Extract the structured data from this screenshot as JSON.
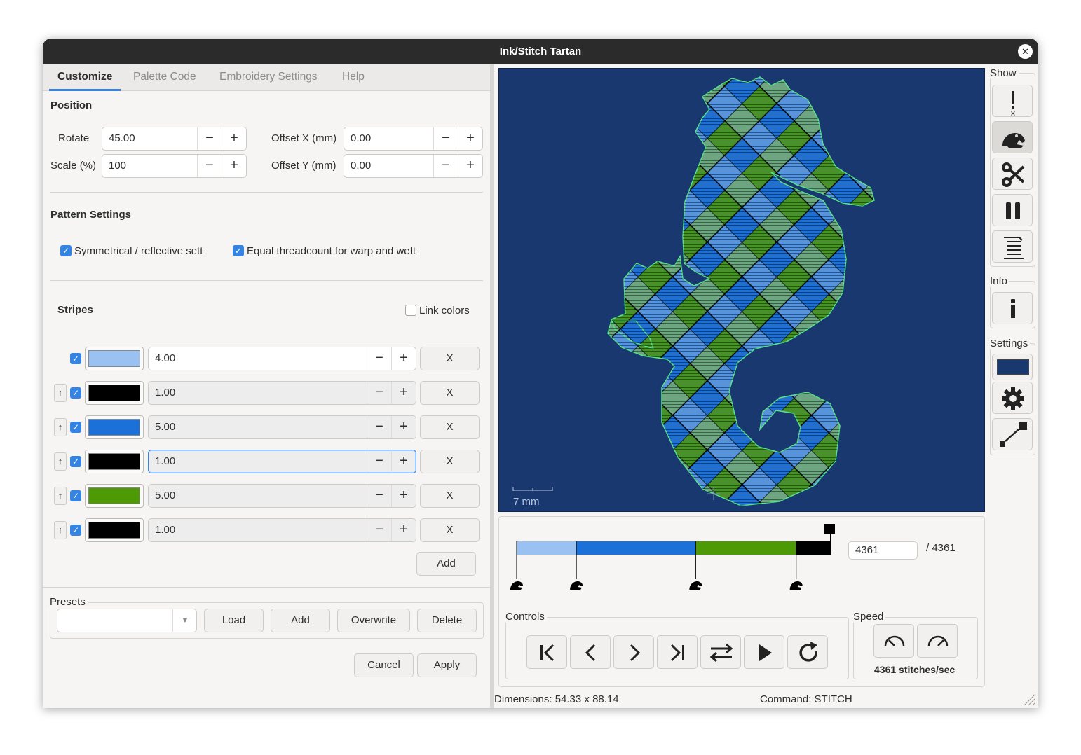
{
  "window": {
    "title": "Ink/Stitch Tartan"
  },
  "tabs": [
    {
      "label": "Customize",
      "active": true
    },
    {
      "label": "Palette Code",
      "active": false
    },
    {
      "label": "Embroidery Settings",
      "active": false
    },
    {
      "label": "Help",
      "active": false
    }
  ],
  "position": {
    "title": "Position",
    "rotate_label": "Rotate",
    "rotate_value": "45.00",
    "scale_label": "Scale (%)",
    "scale_value": "100",
    "offset_x_label": "Offset X (mm)",
    "offset_x_value": "0.00",
    "offset_y_label": "Offset Y (mm)",
    "offset_y_value": "0.00"
  },
  "pattern": {
    "title": "Pattern Settings",
    "symmetrical_label": "Symmetrical / reflective sett",
    "symmetrical_checked": true,
    "equal_label": "Equal threadcount for warp and weft",
    "equal_checked": true
  },
  "stripes": {
    "title": "Stripes",
    "link_colors_label": "Link colors",
    "link_colors_checked": false,
    "rows": [
      {
        "color": "#99c1f1",
        "value": "4.00",
        "remove": "X"
      },
      {
        "color": "#000000",
        "value": "1.00",
        "remove": "X"
      },
      {
        "color": "#1c71d8",
        "value": "5.00",
        "remove": "X"
      },
      {
        "color": "#000000",
        "value": "1.00",
        "remove": "X"
      },
      {
        "color": "#4e9a06",
        "value": "5.00",
        "remove": "X"
      },
      {
        "color": "#000000",
        "value": "1.00",
        "remove": "X"
      }
    ],
    "add_label": "Add"
  },
  "presets": {
    "title": "Presets",
    "select_value": "",
    "load_label": "Load",
    "add_label": "Add",
    "overwrite_label": "Overwrite",
    "delete_label": "Delete"
  },
  "footer": {
    "cancel_label": "Cancel",
    "apply_label": "Apply"
  },
  "preview": {
    "background": "#1a3870",
    "scale_label": "7 mm"
  },
  "sidebar": {
    "show_title": "Show",
    "info_title": "Info",
    "settings_title": "Settings",
    "show_icons": [
      "jump-stitch-icon",
      "trim-frog-icon",
      "scissors-icon",
      "pause-icon",
      "stitch-lines-icon"
    ],
    "background_color": "#1a3870"
  },
  "timeline": {
    "current": "4361",
    "total": "/ 4361",
    "segments": [
      {
        "color": "#99c1f1",
        "fraction": 0.19
      },
      {
        "color": "#1c71d8",
        "fraction": 0.38
      },
      {
        "color": "#4e9a06",
        "fraction": 0.32
      },
      {
        "color": "#000000",
        "fraction": 0.11
      }
    ]
  },
  "controls": {
    "title": "Controls"
  },
  "speed": {
    "title": "Speed",
    "value": "4361 stitches/sec"
  },
  "status": {
    "dimensions": "Dimensions: 54.33 x 88.14",
    "command": "Command: STITCH"
  }
}
